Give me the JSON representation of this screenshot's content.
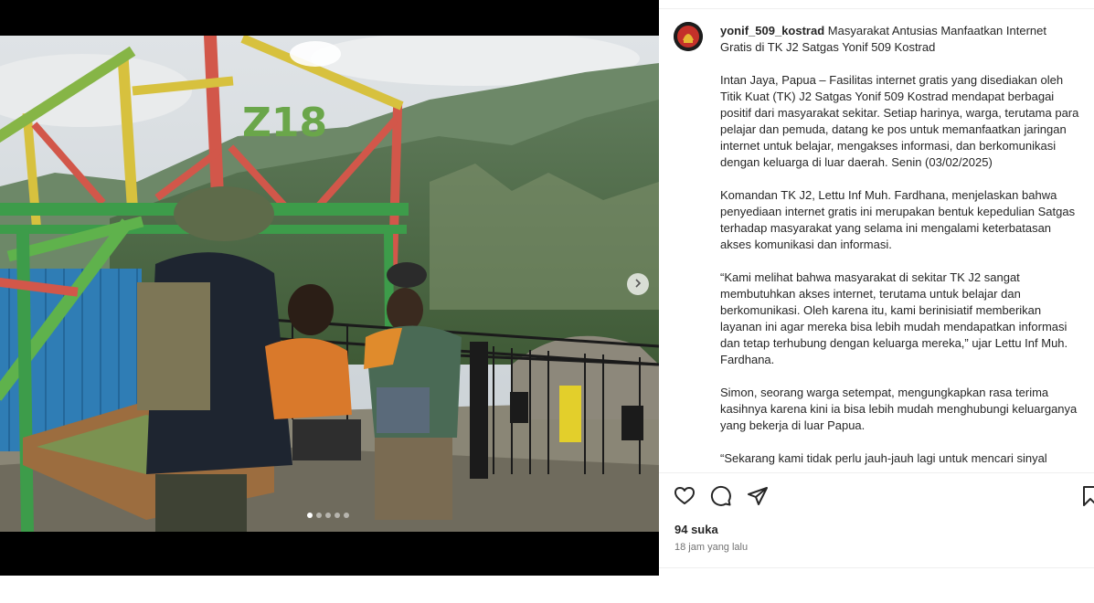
{
  "post": {
    "username": "yonif_509_kostrad",
    "title": "Masyarakat Antusias Manfaatkan Internet Gratis di TK J2 Satgas Yonif 509 Kostrad",
    "paragraphs": [
      "Intan Jaya, Papua – Fasilitas internet gratis yang disediakan oleh Titik Kuat (TK) J2 Satgas Yonif 509 Kostrad mendapat berbagai positif dari masyarakat sekitar. Setiap harinya, warga, terutama para pelajar dan pemuda, datang ke pos untuk memanfaatkan jaringan internet untuk belajar, mengakses informasi, dan berkomunikasi dengan keluarga di luar daerah. Senin (03/02/2025)",
      "Komandan TK J2, Lettu Inf Muh. Fardhana, menjelaskan bahwa penyediaan internet gratis ini merupakan bentuk kepedulian Satgas terhadap masyarakat yang selama ini mengalami keterbatasan akses komunikasi dan informasi.",
      "“Kami melihat bahwa masyarakat di sekitar TK J2 sangat membutuhkan akses internet, terutama untuk belajar dan berkomunikasi. Oleh karena itu, kami berinisiatif memberikan layanan ini agar mereka bisa lebih mudah mendapatkan informasi dan tetap terhubung dengan keluarga mereka,” ujar Lettu Inf Muh. Fardhana.",
      "Simon, seorang warga setempat, mengungkapkan rasa terima kasihnya karena kini ia bisa lebih mudah menghubungi keluarganya yang bekerja di luar Papua.",
      "“Sekarang kami tidak perlu jauh-jauh lagi untuk mencari sinyal"
    ],
    "likes": "94 suka",
    "timestamp": "18 jam yang lalu",
    "sign_text": "Z18"
  },
  "icons": {
    "like": "heart-icon",
    "comment": "comment-icon",
    "share": "paper-plane-icon",
    "save": "bookmark-icon",
    "next": "chevron-right-icon"
  },
  "carousel": {
    "slides": 5,
    "active_index": 0
  }
}
